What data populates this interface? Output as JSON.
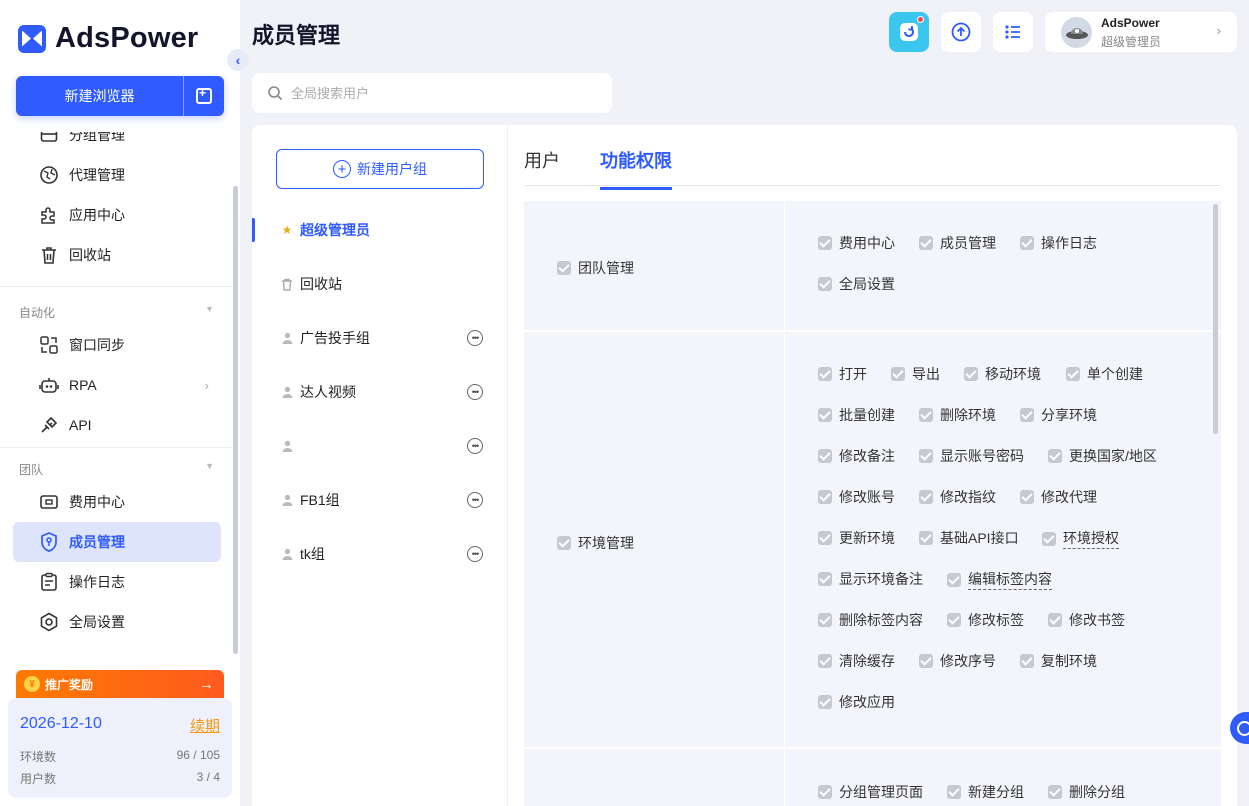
{
  "brand": {
    "name": "AdsPower"
  },
  "sidebar": {
    "new_browser_label": "新建浏览器",
    "items_top": [
      {
        "label": "分组管理",
        "icon": "folder-icon"
      },
      {
        "label": "代理管理",
        "icon": "proxy-icon"
      },
      {
        "label": "应用中心",
        "icon": "puzzle-icon"
      },
      {
        "label": "回收站",
        "icon": "trash-icon"
      }
    ],
    "section_automation": "自动化",
    "items_automation": [
      {
        "label": "窗口同步",
        "icon": "sync-icon"
      },
      {
        "label": "RPA",
        "icon": "robot-icon"
      },
      {
        "label": "API",
        "icon": "plug-icon"
      }
    ],
    "section_team": "团队",
    "items_team": [
      {
        "label": "费用中心",
        "icon": "wallet-icon"
      },
      {
        "label": "成员管理",
        "icon": "shield-icon"
      },
      {
        "label": "操作日志",
        "icon": "clipboard-icon"
      },
      {
        "label": "全局设置",
        "icon": "settings-icon"
      }
    ],
    "promo": {
      "label": "推广奖励",
      "arrow": "→"
    },
    "plan": {
      "expiry": "2026-12-10",
      "renew_label": "续期",
      "env_label": "环境数",
      "env_value": "96 / 105",
      "user_label": "用户数",
      "user_value": "3 / 4"
    }
  },
  "header": {
    "title": "成员管理",
    "user": {
      "name": "AdsPower",
      "role": "超级管理员"
    }
  },
  "search": {
    "placeholder": "全局搜索用户"
  },
  "groups": {
    "new_group_label": "新建用户组",
    "list": [
      {
        "label": "超级管理员",
        "active": true
      },
      {
        "label": "回收站"
      },
      {
        "label": "广告投手组"
      },
      {
        "label": "达人视频"
      },
      {
        "label": ""
      },
      {
        "label": "FB1组"
      },
      {
        "label": "tk组"
      }
    ]
  },
  "tabs": [
    {
      "label": "用户",
      "active": false
    },
    {
      "label": "功能权限",
      "active": true
    }
  ],
  "permissions": [
    {
      "name": "团队管理",
      "items": [
        "费用中心",
        "成员管理",
        "操作日志",
        "全局设置"
      ]
    },
    {
      "name": "环境管理",
      "items": [
        "打开",
        "导出",
        "移动环境",
        "单个创建",
        "批量创建",
        "删除环境",
        "分享环境",
        "修改备注",
        "显示账号密码",
        "更换国家/地区",
        "修改账号",
        "修改指纹",
        "修改代理",
        "更新环境",
        "基础API接口",
        "环境授权",
        "显示环境备注",
        "编辑标签内容",
        "删除标签内容",
        "修改标签",
        "修改书签",
        "清除缓存",
        "修改序号",
        "复制环境",
        "修改应用"
      ]
    },
    {
      "name": "",
      "items": [
        "分组管理页面",
        "新建分组",
        "删除分组"
      ]
    }
  ],
  "colors": {
    "accent": "#2f5bff",
    "promo": "#ff7a00",
    "renew": "#f29a12"
  }
}
